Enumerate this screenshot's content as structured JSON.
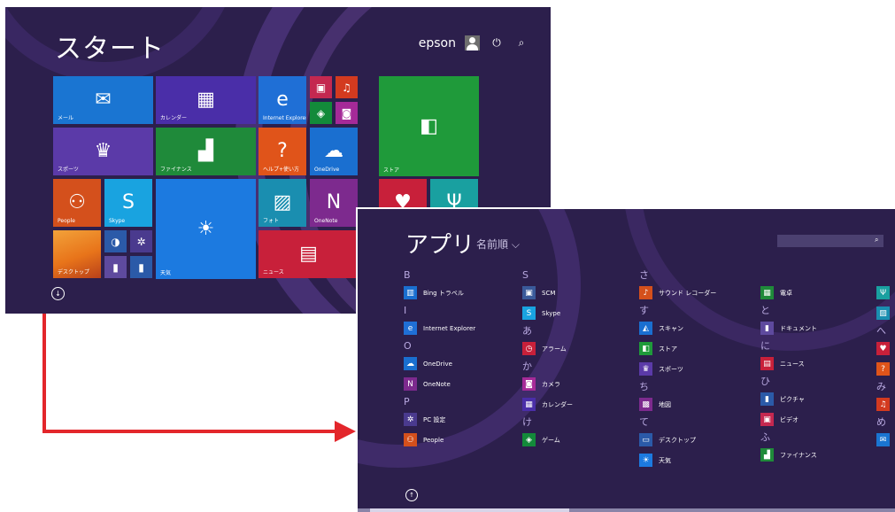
{
  "colors": {
    "background": "#2c1f4c",
    "arrow": "#e3262b"
  },
  "start": {
    "title": "スタート",
    "user": "epson",
    "tiles": [
      {
        "label": "メール",
        "color": "#1a75d2",
        "icon": "mail-icon",
        "glyph": "✉"
      },
      {
        "label": "カレンダー",
        "color": "#4a2ea8",
        "icon": "calendar-icon",
        "glyph": "▦"
      },
      {
        "label": "Internet Explorer",
        "color": "#1f6fd6",
        "icon": "internet-explorer-icon",
        "glyph": "e"
      },
      {
        "label": "",
        "color": "#c42850",
        "icon": "video-icon",
        "glyph": "▣"
      },
      {
        "label": "",
        "color": "#d33a1f",
        "icon": "music-icon",
        "glyph": "♫"
      },
      {
        "label": "",
        "color": "#138a3a",
        "icon": "games-icon",
        "glyph": "◈"
      },
      {
        "label": "",
        "color": "#a52a98",
        "icon": "camera-icon",
        "glyph": "◙"
      },
      {
        "label": "スポーツ",
        "color": "#5b3aa8",
        "icon": "trophy-icon",
        "glyph": "♛"
      },
      {
        "label": "ファイナンス",
        "color": "#1f8a3a",
        "icon": "finance-icon",
        "glyph": "▟"
      },
      {
        "label": "ヘルプ+使い方",
        "color": "#e0541a",
        "icon": "help-icon",
        "glyph": "?"
      },
      {
        "label": "OneDrive",
        "color": "#1a6fd0",
        "icon": "onedrive-icon",
        "glyph": "☁"
      },
      {
        "label": "ストア",
        "color": "#1f9a3a",
        "icon": "store-icon",
        "glyph": "◧"
      },
      {
        "label": "People",
        "color": "#d4501c",
        "icon": "people-icon",
        "glyph": "⚇"
      },
      {
        "label": "Skype",
        "color": "#19a3e0",
        "icon": "skype-icon",
        "glyph": "S"
      },
      {
        "label": "天気",
        "color": "#1c7ae0",
        "icon": "weather-icon",
        "glyph": "☀"
      },
      {
        "label": "フォト",
        "color": "#1a8eb0",
        "icon": "photo-icon",
        "glyph": "▨"
      },
      {
        "label": "OneNote",
        "color": "#7d2a8e",
        "icon": "onenote-icon",
        "glyph": "N"
      },
      {
        "label": "",
        "color": "#c8203a",
        "icon": "health-icon",
        "glyph": "♥"
      },
      {
        "label": "",
        "color": "#19a0a0",
        "icon": "food-icon",
        "glyph": "Ψ"
      },
      {
        "label": "デスクトップ",
        "color": "#e8741a",
        "icon": "desktop-icon",
        "glyph": ""
      },
      {
        "label": "",
        "color": "#2b5aa8",
        "icon": "pc-settings-small-icon",
        "glyph": "◑"
      },
      {
        "label": "",
        "color": "#4a3a8e",
        "icon": "settings-icon",
        "glyph": "✲"
      },
      {
        "label": "",
        "color": "#5e4a9e",
        "icon": "reader-icon",
        "glyph": "▮"
      },
      {
        "label": "",
        "color": "#2b5aa8",
        "icon": "pictures-icon",
        "glyph": "▮"
      },
      {
        "label": "ニュース",
        "color": "#c8203a",
        "icon": "news-icon",
        "glyph": "▤"
      }
    ]
  },
  "apps": {
    "title": "アプリ",
    "sort": "名前順 ⌵",
    "columns": [
      [
        {
          "type": "group",
          "text": "B"
        },
        {
          "type": "app",
          "name": "Bing トラベル",
          "color": "#1a6fd0",
          "icon": "travel-icon",
          "glyph": "▥"
        },
        {
          "type": "group",
          "text": "I"
        },
        {
          "type": "app",
          "name": "Internet Explorer",
          "color": "#1f6fd6",
          "icon": "internet-explorer-icon",
          "glyph": "e"
        },
        {
          "type": "group",
          "text": "O"
        },
        {
          "type": "app",
          "name": "OneDrive",
          "color": "#1a6fd0",
          "icon": "onedrive-icon",
          "glyph": "☁"
        },
        {
          "type": "app",
          "name": "OneNote",
          "color": "#7d2a8e",
          "icon": "onenote-icon",
          "glyph": "N"
        },
        {
          "type": "group",
          "text": "P"
        },
        {
          "type": "app",
          "name": "PC 設定",
          "color": "#4a3a8e",
          "icon": "pc-settings-icon",
          "glyph": "✲"
        },
        {
          "type": "app",
          "name": "People",
          "color": "#d4501c",
          "icon": "people-icon",
          "glyph": "⚇"
        }
      ],
      [
        {
          "type": "group",
          "text": "S"
        },
        {
          "type": "app",
          "name": "SCM",
          "color": "#3a5a9a",
          "icon": "scm-icon",
          "glyph": "▣"
        },
        {
          "type": "app",
          "name": "Skype",
          "color": "#19a3e0",
          "icon": "skype-icon",
          "glyph": "S"
        },
        {
          "type": "group",
          "text": "あ"
        },
        {
          "type": "app",
          "name": "アラーム",
          "color": "#c8203a",
          "icon": "alarm-icon",
          "glyph": "◷"
        },
        {
          "type": "group",
          "text": "か"
        },
        {
          "type": "app",
          "name": "カメラ",
          "color": "#a52a98",
          "icon": "camera-icon",
          "glyph": "◙"
        },
        {
          "type": "app",
          "name": "カレンダー",
          "color": "#4a2ea8",
          "icon": "calendar-icon",
          "glyph": "▦"
        },
        {
          "type": "group",
          "text": "け"
        },
        {
          "type": "app",
          "name": "ゲーム",
          "color": "#138a3a",
          "icon": "games-icon",
          "glyph": "◈"
        }
      ],
      [
        {
          "type": "group",
          "text": "さ"
        },
        {
          "type": "app",
          "name": "サウンド レコーダー",
          "color": "#d4501c",
          "icon": "microphone-icon",
          "glyph": "♪"
        },
        {
          "type": "group",
          "text": "す"
        },
        {
          "type": "app",
          "name": "スキャン",
          "color": "#1a6fd0",
          "icon": "scan-icon",
          "glyph": "◭"
        },
        {
          "type": "app",
          "name": "ストア",
          "color": "#1f9a3a",
          "icon": "store-icon",
          "glyph": "◧"
        },
        {
          "type": "app",
          "name": "スポーツ",
          "color": "#5b3aa8",
          "icon": "trophy-icon",
          "glyph": "♛"
        },
        {
          "type": "group",
          "text": "ち"
        },
        {
          "type": "app",
          "name": "地図",
          "color": "#7d2a8e",
          "icon": "maps-icon",
          "glyph": "▩"
        },
        {
          "type": "group",
          "text": "て"
        },
        {
          "type": "app",
          "name": "デスクトップ",
          "color": "#2b5aa8",
          "icon": "desktop-icon",
          "glyph": "▭"
        },
        {
          "type": "app",
          "name": "天気",
          "color": "#1c7ae0",
          "icon": "weather-icon",
          "glyph": "☀"
        }
      ],
      [
        {
          "type": "group",
          "text": ""
        },
        {
          "type": "app",
          "name": "電卓",
          "color": "#1f8a3a",
          "icon": "calculator-icon",
          "glyph": "▦"
        },
        {
          "type": "group",
          "text": "と"
        },
        {
          "type": "app",
          "name": "ドキュメント",
          "color": "#5e4a9e",
          "icon": "documents-icon",
          "glyph": "▮"
        },
        {
          "type": "group",
          "text": "に"
        },
        {
          "type": "app",
          "name": "ニュース",
          "color": "#c8203a",
          "icon": "news-icon",
          "glyph": "▤"
        },
        {
          "type": "group",
          "text": "ひ"
        },
        {
          "type": "app",
          "name": "ピクチャ",
          "color": "#2b5aa8",
          "icon": "pictures-icon",
          "glyph": "▮"
        },
        {
          "type": "app",
          "name": "ビデオ",
          "color": "#c42850",
          "icon": "video-icon",
          "glyph": "▣"
        },
        {
          "type": "group",
          "text": "ふ"
        },
        {
          "type": "app",
          "name": "ファイナンス",
          "color": "#1f8a3a",
          "icon": "finance-icon",
          "glyph": "▟"
        }
      ],
      [
        {
          "type": "group",
          "text": ""
        },
        {
          "type": "app",
          "name": "",
          "color": "#19a0a0",
          "icon": "food-icon",
          "glyph": "Ψ"
        },
        {
          "type": "app",
          "name": "",
          "color": "#1a8eb0",
          "icon": "photo-icon",
          "glyph": "▨"
        },
        {
          "type": "group",
          "text": "へ"
        },
        {
          "type": "app",
          "name": "",
          "color": "#c8203a",
          "icon": "health-icon",
          "glyph": "♥"
        },
        {
          "type": "app",
          "name": "",
          "color": "#e0541a",
          "icon": "help-icon",
          "glyph": "?"
        },
        {
          "type": "group",
          "text": "み"
        },
        {
          "type": "app",
          "name": "",
          "color": "#d33a1f",
          "icon": "music-icon",
          "glyph": "♫"
        },
        {
          "type": "group",
          "text": "め"
        },
        {
          "type": "app",
          "name": "",
          "color": "#1a75d2",
          "icon": "mail-icon",
          "glyph": "✉"
        }
      ]
    ]
  }
}
